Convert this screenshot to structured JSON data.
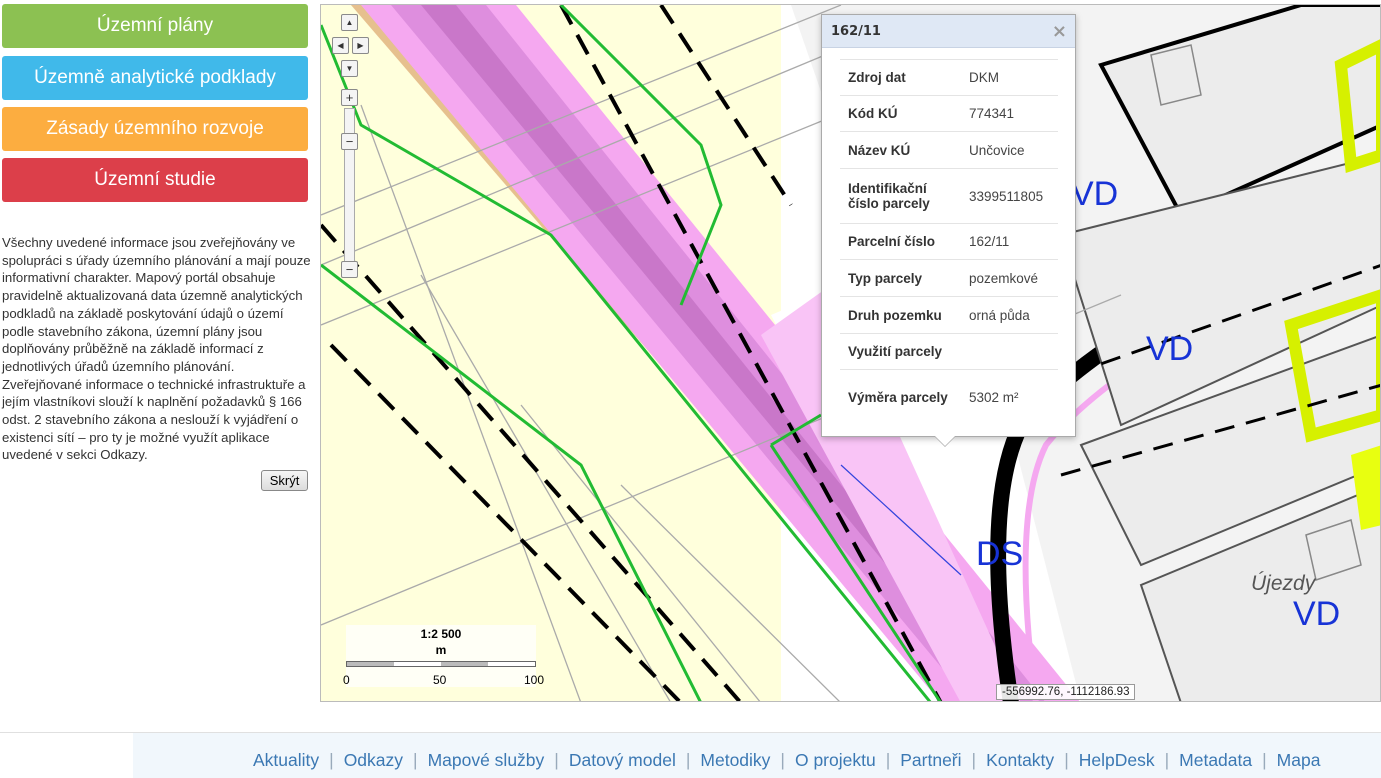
{
  "sidebar": {
    "buttons": [
      {
        "label": "Územní plány",
        "color": "#8cc152"
      },
      {
        "label": "Územně analytické podklady",
        "color": "#40b9ea"
      },
      {
        "label": "Zásady územního rozvoje",
        "color": "#fcad40"
      },
      {
        "label": "Územní studie",
        "color": "#dc3f4a"
      }
    ],
    "info_text": "Všechny uvedené informace jsou zveřejňovány ve spolupráci s úřady územního plánování a mají pouze informativní charakter. Mapový portál obsahuje pravidelně aktualizovaná data územně analytických podkladů na základě poskytování údajů o území podle stavebního zákona, územní plány jsou doplňovány průběžně na základě informací z jednotlivých úřadů územního plánování. Zveřejňované informace o technické infrastruktuře a jejím vlastníkovi slouží k naplnění požadavků § 166 odst. 2 stavebního zákona a neslouží k vyjádření o existenci sítí – pro ty je možné využít aplikace uvedené v sekci Odkazy.",
    "hide_label": "Skrýt"
  },
  "map": {
    "labels": {
      "vd1": "VD",
      "vd2": "VD",
      "vd3": "VD",
      "ds": "DS",
      "place": "Újezdy"
    },
    "scale": {
      "ratio": "1:2 500",
      "unit": "m",
      "ticks": [
        "0",
        "50",
        "100"
      ]
    },
    "coordinates": "-556992.76, -1112186.93",
    "zoom_controls": {
      "plus": "+",
      "minus": "−"
    }
  },
  "popup": {
    "title": "162/11",
    "close": "×",
    "rows": [
      {
        "key": "Zdroj dat",
        "value": "DKM"
      },
      {
        "key": "Kód KÚ",
        "value": "774341"
      },
      {
        "key": "Název KÚ",
        "value": "Unčovice"
      },
      {
        "key": "Identifikační číslo parcely",
        "value": "3399511805"
      },
      {
        "key": "Parcelní číslo",
        "value": "162/11"
      },
      {
        "key": "Typ parcely",
        "value": "pozemkové"
      },
      {
        "key": "Druh pozemku",
        "value": "orná půda"
      },
      {
        "key": "Využití parcely",
        "value": ""
      },
      {
        "key": "Výměra parcely",
        "value": "5302 m²"
      }
    ]
  },
  "footer": {
    "links": [
      "Aktuality",
      "Odkazy",
      "Mapové služby",
      "Datový model",
      "Metodiky",
      "O projektu",
      "Partneři",
      "Kontakty",
      "HelpDesk",
      "Metadata",
      "Mapa"
    ],
    "separator": "|"
  }
}
